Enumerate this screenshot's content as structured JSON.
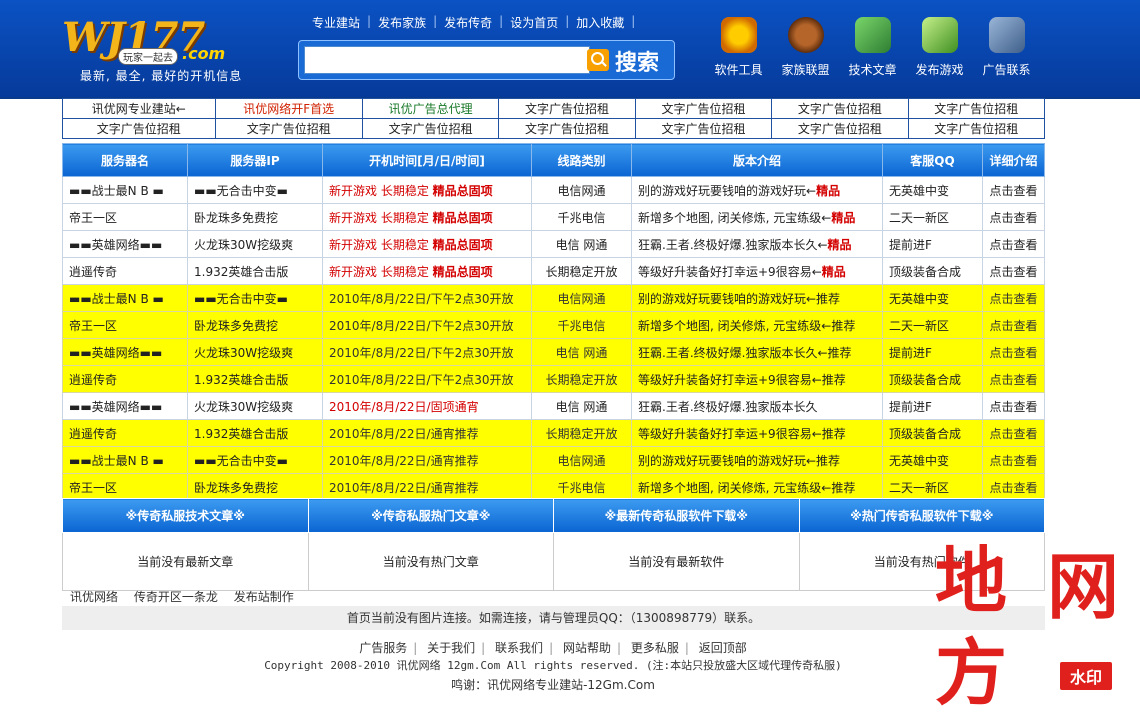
{
  "logo": {
    "main": "WJ177",
    "badge": "玩家一起去",
    "com": ".com",
    "slogan": "最新, 最全, 最好的开机信息"
  },
  "topnav": [
    "专业建站",
    "发布家族",
    "发布传奇",
    "设为首页",
    "加入收藏"
  ],
  "search": {
    "value": "",
    "button": "搜索"
  },
  "tools": [
    {
      "label": "软件工具",
      "icon": "gear-icon"
    },
    {
      "label": "家族联盟",
      "icon": "ship-wheel-icon"
    },
    {
      "label": "技术文章",
      "icon": "book-icon"
    },
    {
      "label": "发布游戏",
      "icon": "controller-icon"
    },
    {
      "label": "广告联系",
      "icon": "gamepad-icon"
    }
  ],
  "ads": [
    [
      "讯优网专业建站←",
      "讯优网络开F首选",
      "讯优广告总代理",
      "文字广告位招租",
      "文字广告位招租",
      "文字广告位招租",
      "文字广告位招租"
    ],
    [
      "文字广告位招租",
      "文字广告位招租",
      "文字广告位招租",
      "文字广告位招租",
      "文字广告位招租",
      "文字广告位招租",
      "文字广告位招租"
    ]
  ],
  "servers": {
    "headers": [
      "服务器名",
      "服务器IP",
      "开机时间[月/日/时间]",
      "线路类别",
      "版本介绍",
      "客服QQ",
      "详细介绍"
    ],
    "rows": [
      {
        "style": "white",
        "name": "▬▬战士最N B ▬",
        "ip": "▬▬无合击中变▬",
        "time": "新开游戏  长期稳定",
        "time_bold": "精品总固项",
        "line": "电信网通",
        "ver": "别的游戏好玩要钱咱的游戏好玩←",
        "ver_bold": "精品",
        "qq": "无英雄中变",
        "detail": "点击查看"
      },
      {
        "style": "white",
        "name": "帝王一区",
        "ip": "卧龙珠多免费挖",
        "time": "新开游戏  长期稳定",
        "time_bold": "精品总固项",
        "line": "千兆电信",
        "ver": "新增多个地图, 闭关修炼, 元宝练级←",
        "ver_bold": "精品",
        "qq": "二天一新区",
        "detail": "点击查看"
      },
      {
        "style": "white",
        "name": "▬▬英雄网络▬▬",
        "ip": "火龙珠30W挖级爽",
        "time": "新开游戏  长期稳定",
        "time_bold": "精品总固项",
        "line": "电信 网通",
        "ver": "狂霸.王者.终极好爆.独家版本长久←",
        "ver_bold": "精品",
        "qq": "提前进F",
        "detail": "点击查看"
      },
      {
        "style": "white",
        "name": "逍遥传奇",
        "ip": "1.932英雄合击版",
        "time": "新开游戏  长期稳定",
        "time_bold": "精品总固项",
        "line": "长期稳定开放",
        "ver": "等级好升装备好打幸运+9很容易←",
        "ver_bold": "精品",
        "qq": "顶级装备合成",
        "detail": "点击查看"
      },
      {
        "style": "yellow",
        "name": "▬▬战士最N B ▬",
        "ip": "▬▬无合击中变▬",
        "time": "2010年/8月/22日/下午2点30开放",
        "time_bold": "",
        "line": "电信网通",
        "ver": "别的游戏好玩要钱咱的游戏好玩←推荐",
        "ver_bold": "",
        "qq": "无英雄中变",
        "detail": "点击查看"
      },
      {
        "style": "yellow",
        "name": "帝王一区",
        "ip": "卧龙珠多免费挖",
        "time": "2010年/8月/22日/下午2点30开放",
        "time_bold": "",
        "line": "千兆电信",
        "ver": "新增多个地图, 闭关修炼, 元宝练级←推荐",
        "ver_bold": "",
        "qq": "二天一新区",
        "detail": "点击查看"
      },
      {
        "style": "yellow",
        "name": "▬▬英雄网络▬▬",
        "ip": "火龙珠30W挖级爽",
        "time": "2010年/8月/22日/下午2点30开放",
        "time_bold": "",
        "line": "电信 网通",
        "ver": "狂霸.王者.终极好爆.独家版本长久←推荐",
        "ver_bold": "",
        "qq": "提前进F",
        "detail": "点击查看"
      },
      {
        "style": "yellow",
        "name": "逍遥传奇",
        "ip": "1.932英雄合击版",
        "time": "2010年/8月/22日/下午2点30开放",
        "time_bold": "",
        "line": "长期稳定开放",
        "ver": "等级好升装备好打幸运+9很容易←推荐",
        "ver_bold": "",
        "qq": "顶级装备合成",
        "detail": "点击查看"
      },
      {
        "style": "white",
        "name": "▬▬英雄网络▬▬",
        "ip": "火龙珠30W挖级爽",
        "time": "2010年/8月/22日/固项通宵",
        "time_bold": "",
        "line": "电信 网通",
        "ver": "狂霸.王者.终极好爆.独家版本长久",
        "ver_bold": "",
        "qq": "提前进F",
        "detail": "点击查看"
      },
      {
        "style": "yellow",
        "name": "逍遥传奇",
        "ip": "1.932英雄合击版",
        "time": "2010年/8月/22日/通宵推荐",
        "time_bold": "",
        "line": "长期稳定开放",
        "ver": "等级好升装备好打幸运+9很容易←推荐",
        "ver_bold": "",
        "qq": "顶级装备合成",
        "detail": "点击查看"
      },
      {
        "style": "yellow",
        "name": "▬▬战士最N B ▬",
        "ip": "▬▬无合击中变▬",
        "time": "2010年/8月/22日/通宵推荐",
        "time_bold": "",
        "line": "电信网通",
        "ver": "别的游戏好玩要钱咱的游戏好玩←推荐",
        "ver_bold": "",
        "qq": "无英雄中变",
        "detail": "点击查看"
      },
      {
        "style": "yellow",
        "name": "帝王一区",
        "ip": "卧龙珠多免费挖",
        "time": "2010年/8月/22日/通宵推荐",
        "time_bold": "",
        "line": "千兆电信",
        "ver": "新增多个地图, 闭关修炼, 元宝练级←推荐",
        "ver_bold": "",
        "qq": "二天一新区",
        "detail": "点击查看"
      }
    ]
  },
  "sections": [
    {
      "title": "※传奇私服技术文章※",
      "empty": "当前没有最新文章"
    },
    {
      "title": "※传奇私服热门文章※",
      "empty": "当前没有热门文章"
    },
    {
      "title": "※最新传奇私服软件下载※",
      "empty": "当前没有最新软件"
    },
    {
      "title": "※热门传奇私服软件下载※",
      "empty": "当前没有热门软件"
    }
  ],
  "footlinks": [
    "讯优网络",
    "传奇开区一条龙",
    "发布站制作"
  ],
  "notice": "首页当前没有图片连接。如需连接，请与管理员QQ：（1300898779）联系。",
  "footnav": [
    "广告服务",
    "关于我们",
    "联系我们",
    "网站帮助",
    "更多私服",
    "返回顶部"
  ],
  "copyright": "Copyright 2008-2010 讯优网络 12gm.Com All rights reserved. (注:本站只投放盛大区域代理传奇私服)",
  "thanks": "鸣谢：讯优网络专业建站-12Gm.Com",
  "watermark": {
    "chars": [
      "地",
      "网",
      "方"
    ],
    "tag": "水印"
  }
}
